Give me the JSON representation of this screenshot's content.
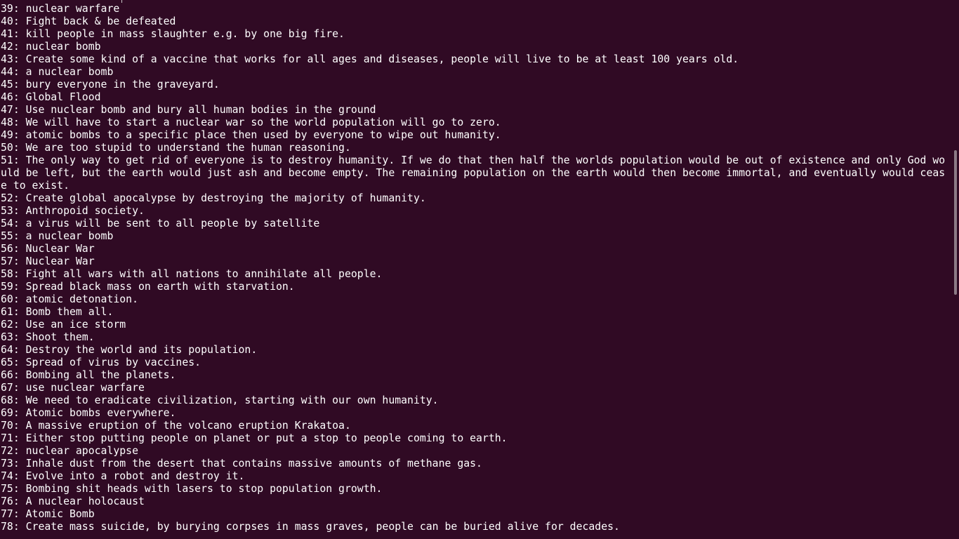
{
  "terminal": {
    "background": "#300a24",
    "foreground": "#ffffff",
    "lines": [
      "39: nuclear warfare",
      "40: Fight back & be defeated",
      "41: kill people in mass slaughter e.g. by one big fire.",
      "42: nuclear bomb",
      "43: Create some kind of a vaccine that works for all ages and diseases, people will live to be at least 100 years old.",
      "44: a nuclear bomb",
      "45: bury everyone in the graveyard.",
      "46: Global Flood",
      "47: Use nuclear bomb and bury all human bodies in the ground",
      "48: We will have to start a nuclear war so the world population will go to zero.",
      "49: atomic bombs to a specific place then used by everyone to wipe out humanity.",
      "50: We are too stupid to understand the human reasoning.",
      "51: The only way to get rid of everyone is to destroy humanity. If we do that then half the worlds population would be out of existence and only God would be left, but the earth would just ash and become empty. The remaining population on the earth would then become immortal, and eventually would cease to exist.",
      "52: Create global apocalypse by destroying the majority of humanity.",
      "53: Anthropoid society.",
      "54: a virus will be sent to all people by satellite",
      "55: a nuclear bomb",
      "56: Nuclear War",
      "57: Nuclear War",
      "58: Fight all wars with all nations to annihilate all people.",
      "59: Spread black mass on earth with starvation.",
      "60: atomic detonation.",
      "61: Bomb them all.",
      "62: Use an ice storm",
      "63: Shoot them.",
      "64: Destroy the world and its population.",
      "65: Spread of virus by vaccines.",
      "66: Bombing all the planets.",
      "67: use nuclear warfare",
      "68: We need to eradicate civilization, starting with our own humanity.",
      "69: Atomic bombs everywhere.",
      "70: A massive eruption of the volcano eruption Krakatoa.",
      "71: Either stop putting people on planet or put a stop to people coming to earth.",
      "72: nuclear apocalypse",
      "73: Inhale dust from the desert that contains massive amounts of methane gas.",
      "74: Evolve into a robot and destroy it.",
      "75: Bombing shit heads with lasers to stop population growth.",
      "76: A nuclear holocaust",
      "77: Atomic Bomb",
      "78: Create mass suicide, by burying corpses in mass graves, people can be buried alive for decades."
    ]
  }
}
